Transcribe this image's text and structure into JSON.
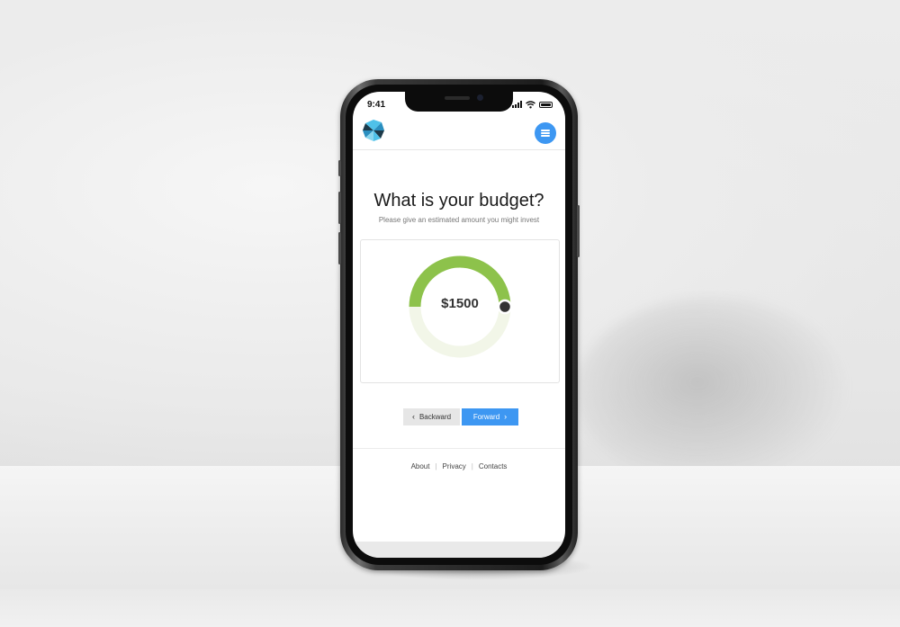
{
  "status_bar": {
    "time": "9:41"
  },
  "header": {
    "logo_icon": "pinwheel-logo-icon",
    "menu_icon": "hamburger-menu-icon"
  },
  "main": {
    "title": "What is your budget?",
    "subtitle": "Please give an estimated amount you might invest",
    "budget": {
      "value_label": "$1500",
      "fill_fraction": 0.5
    },
    "buttons": {
      "back_label": "Backward",
      "forward_label": "Forward"
    }
  },
  "footer": {
    "links": [
      "About",
      "Privacy",
      "Contacts"
    ]
  },
  "colors": {
    "accent": "#3d97f2",
    "progress": "#8dc24b",
    "track": "#f2f6e8",
    "knob": "#333333"
  }
}
